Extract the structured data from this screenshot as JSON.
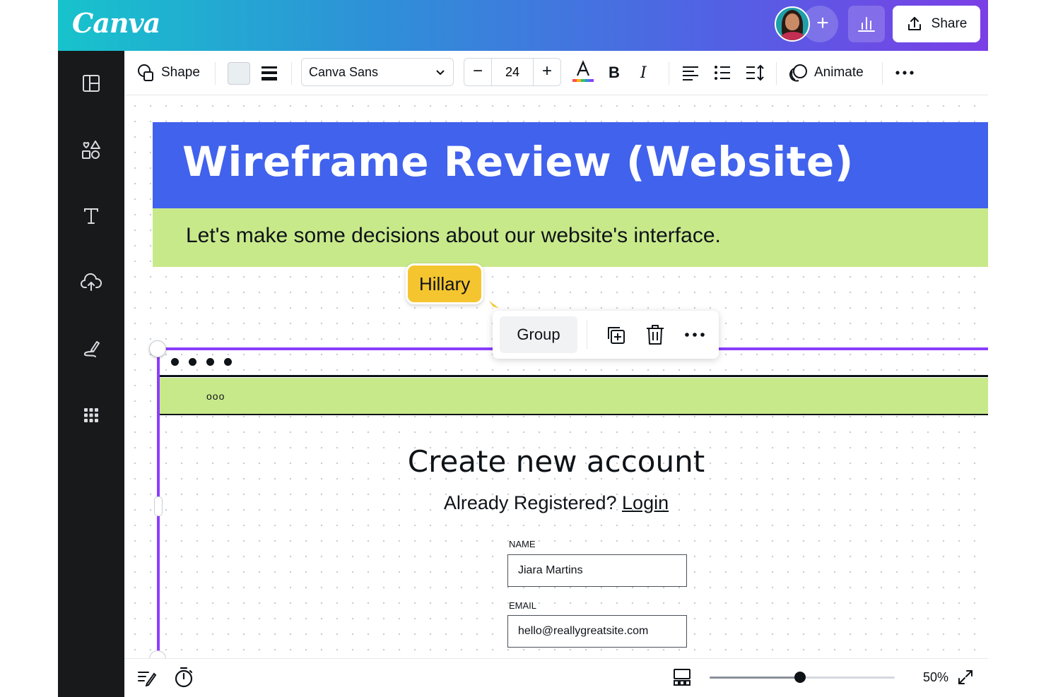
{
  "app": {
    "name": "Canva"
  },
  "header": {
    "share_label": "Share"
  },
  "toolbar": {
    "shape_label": "Shape",
    "font_name": "Canva Sans",
    "font_size": "24",
    "animate_label": "Animate"
  },
  "design": {
    "title": "Wireframe Review (Website)",
    "subtitle": "Let's make some decisions about our website's interface.",
    "collaborator_tag": "Hillary",
    "wireframe": {
      "nav_ooo": "ooo",
      "form_title": "Create new account",
      "form_subtitle": "Already Registered?",
      "login_link": "Login",
      "fields": [
        {
          "label": "NAME",
          "value": "Jiara Martins"
        },
        {
          "label": "EMAIL",
          "value": "hello@reallygreatsite.com"
        }
      ]
    }
  },
  "context_menu": {
    "group_label": "Group"
  },
  "footer": {
    "zoom_label": "50%",
    "zoom_fraction": 0.49
  },
  "colors": {
    "brand_gradient_start": "#17c3cc",
    "brand_gradient_end": "#7b3fe6",
    "title_banner": "#4062ed",
    "subtitle_banner": "#c8e98a",
    "selection": "#8b3dff",
    "collaborator_tag": "#f5c52f"
  },
  "icons": [
    "templates-icon",
    "elements-icon",
    "text-icon",
    "uploads-icon",
    "draw-icon",
    "apps-icon",
    "shape-icon",
    "border-style-icon",
    "text-color-icon",
    "bold-icon",
    "italic-icon",
    "align-left-icon",
    "list-icon",
    "spacing-icon",
    "animate-icon",
    "more-icon",
    "duplicate-icon",
    "trash-icon",
    "notes-icon",
    "timer-icon",
    "pages-icon",
    "fullscreen-icon",
    "insights-icon",
    "share-upload-icon"
  ]
}
